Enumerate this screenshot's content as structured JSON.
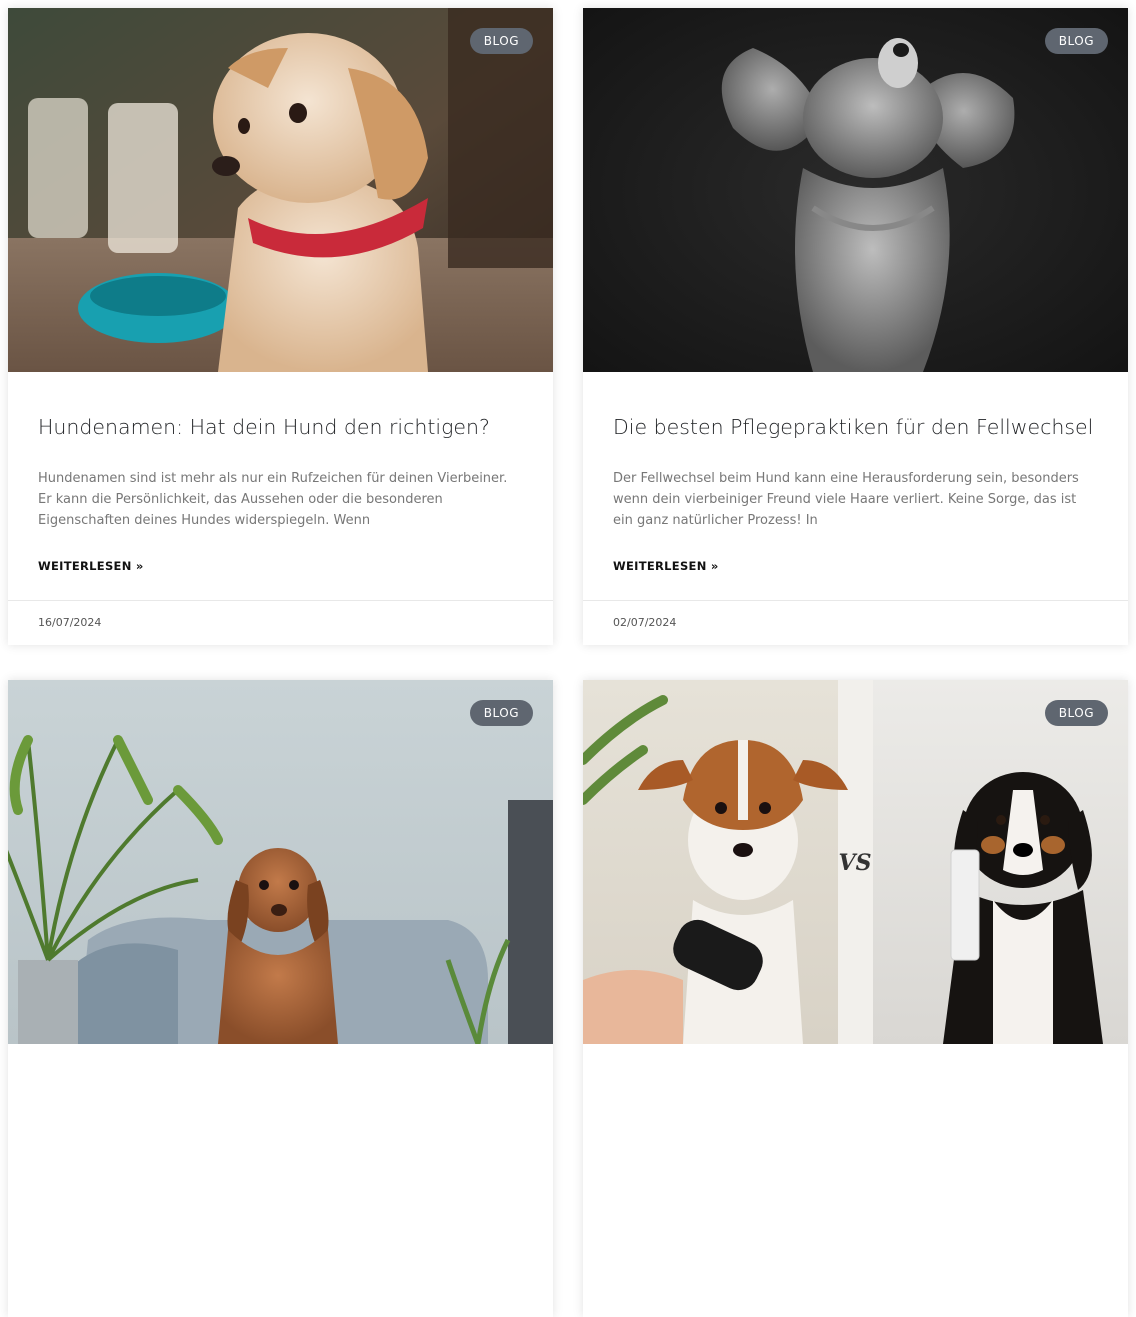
{
  "posts": [
    {
      "badge": "BLOG",
      "image": "golden-puppy-with-red-collar-photo",
      "title": "Hundenamen: Hat dein Hund den richtigen?",
      "excerpt": "Hundenamen sind ist mehr als nur ein Rufzeichen für deinen Vierbeiner. Er kann die Persönlichkeit, das Aussehen oder die besonderen Eigenschaften deines Hundes widerspiegeln. Wenn",
      "read_more": "WEITERLESEN »",
      "date": "16/07/2024"
    },
    {
      "badge": "BLOG",
      "image": "black-white-spaniel-shaking-fur-photo",
      "title": "Die besten Pflegepraktiken für den Fellwechsel",
      "excerpt": "Der Fellwechsel beim Hund kann eine Herausforderung sein, besonders wenn dein vierbeiniger Freund viele Haare verliert. Keine Sorge, das ist ein ganz natürlicher Prozess! In",
      "read_more": "WEITERLESEN »",
      "date": "02/07/2024"
    },
    {
      "badge": "BLOG",
      "image": "brown-dog-on-grey-bed-photo"
    },
    {
      "badge": "BLOG",
      "image": "jack-russell-vs-bernese-dog-photo"
    }
  ],
  "colors": {
    "badge_bg": "#5f6670",
    "title": "#1f2124",
    "excerpt": "#777777"
  }
}
